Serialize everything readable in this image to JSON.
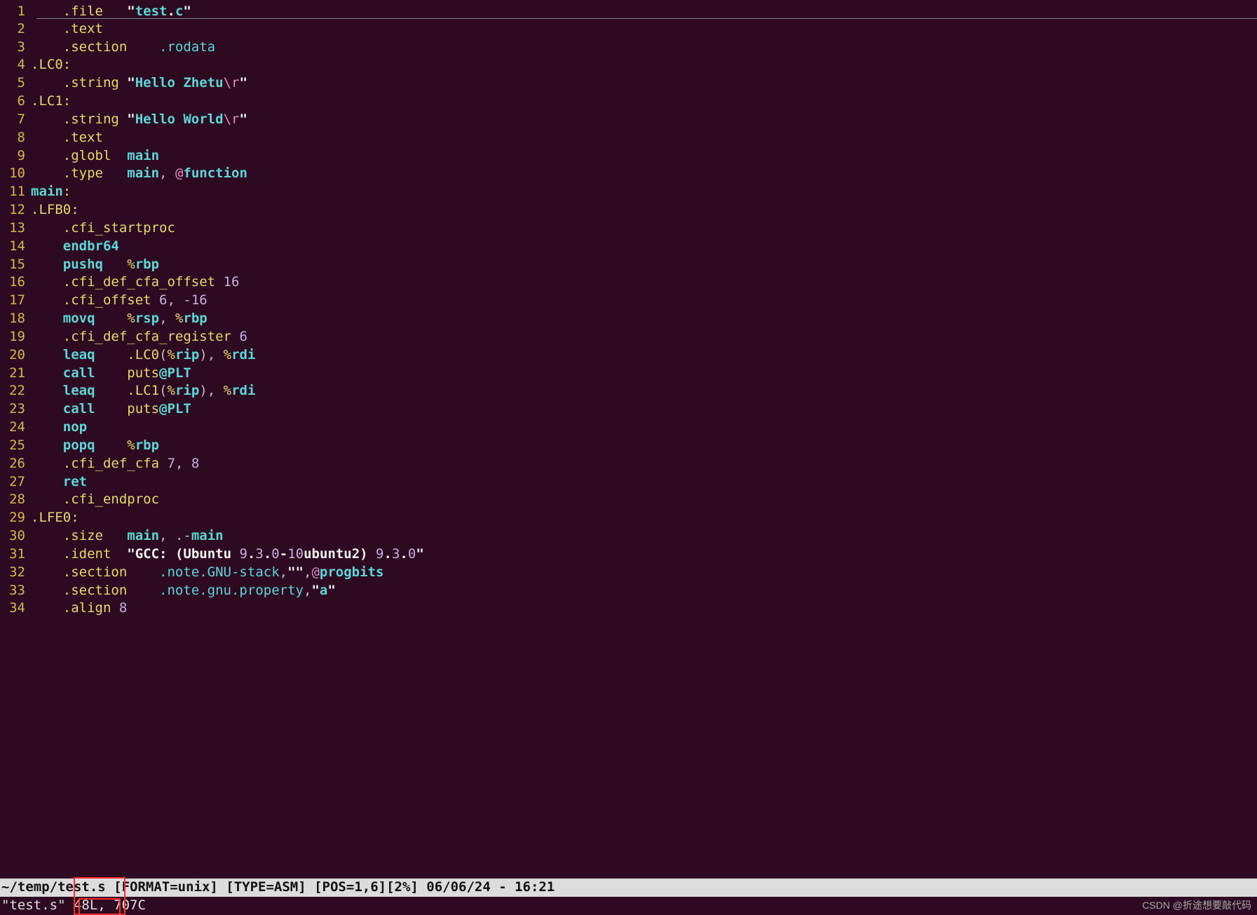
{
  "lines": [
    {
      "n": "1",
      "tokens": [
        [
          "    ",
          "c-grey"
        ],
        [
          ".file   ",
          "c-yellow"
        ],
        [
          "\"",
          "c-white"
        ],
        [
          "test",
          "c-cyanb"
        ],
        [
          ".",
          "c-white"
        ],
        [
          "c",
          "c-cyanb"
        ],
        [
          "\"",
          "c-white"
        ]
      ]
    },
    {
      "n": "2",
      "tokens": [
        [
          "    ",
          "c-grey"
        ],
        [
          ".text",
          "c-yellow"
        ]
      ]
    },
    {
      "n": "3",
      "tokens": [
        [
          "    ",
          "c-grey"
        ],
        [
          ".section    ",
          "c-yellow"
        ],
        [
          ".rodata",
          "c-cyan"
        ]
      ]
    },
    {
      "n": "4",
      "tokens": [
        [
          ".LC0:",
          "c-yellow"
        ]
      ]
    },
    {
      "n": "5",
      "tokens": [
        [
          "    ",
          "c-grey"
        ],
        [
          ".string ",
          "c-yellow"
        ],
        [
          "\"",
          "c-white"
        ],
        [
          "Hello Zhetu",
          "c-cyanb"
        ],
        [
          "\\r",
          "c-pink"
        ],
        [
          "\"",
          "c-white"
        ]
      ]
    },
    {
      "n": "6",
      "tokens": [
        [
          ".LC1:",
          "c-yellow"
        ]
      ]
    },
    {
      "n": "7",
      "tokens": [
        [
          "    ",
          "c-grey"
        ],
        [
          ".string ",
          "c-yellow"
        ],
        [
          "\"",
          "c-white"
        ],
        [
          "Hello World",
          "c-cyanb"
        ],
        [
          "\\r",
          "c-pink"
        ],
        [
          "\"",
          "c-white"
        ]
      ]
    },
    {
      "n": "8",
      "tokens": [
        [
          "    ",
          "c-grey"
        ],
        [
          ".text",
          "c-yellow"
        ]
      ]
    },
    {
      "n": "9",
      "tokens": [
        [
          "    ",
          "c-grey"
        ],
        [
          ".globl  ",
          "c-yellow"
        ],
        [
          "main",
          "c-cyanb"
        ]
      ]
    },
    {
      "n": "10",
      "tokens": [
        [
          "    ",
          "c-grey"
        ],
        [
          ".type   ",
          "c-yellow"
        ],
        [
          "main",
          "c-cyanb"
        ],
        [
          ", ",
          "c-grey"
        ],
        [
          "@",
          "c-pink"
        ],
        [
          "function",
          "c-cyanb"
        ]
      ]
    },
    {
      "n": "11",
      "tokens": [
        [
          "main",
          "c-cyanb"
        ],
        [
          ":",
          "c-yellow"
        ]
      ]
    },
    {
      "n": "12",
      "tokens": [
        [
          ".LFB0:",
          "c-yellow"
        ]
      ]
    },
    {
      "n": "13",
      "tokens": [
        [
          "    ",
          "c-grey"
        ],
        [
          ".cfi_startproc",
          "c-yellow"
        ]
      ]
    },
    {
      "n": "14",
      "tokens": [
        [
          "    ",
          "c-grey"
        ],
        [
          "endbr64",
          "c-cyanb"
        ]
      ]
    },
    {
      "n": "15",
      "tokens": [
        [
          "    ",
          "c-grey"
        ],
        [
          "pushq   ",
          "c-cyanb"
        ],
        [
          "%",
          "c-yellow"
        ],
        [
          "rbp",
          "c-cyanb"
        ]
      ]
    },
    {
      "n": "16",
      "tokens": [
        [
          "    ",
          "c-grey"
        ],
        [
          ".cfi_def_cfa_offset ",
          "c-yellow"
        ],
        [
          "16",
          "c-num"
        ]
      ]
    },
    {
      "n": "17",
      "tokens": [
        [
          "    ",
          "c-grey"
        ],
        [
          ".cfi_offset ",
          "c-yellow"
        ],
        [
          "6",
          "c-num"
        ],
        [
          ", ",
          "c-grey"
        ],
        [
          "-",
          "c-grey"
        ],
        [
          "16",
          "c-num"
        ]
      ]
    },
    {
      "n": "18",
      "tokens": [
        [
          "    ",
          "c-grey"
        ],
        [
          "movq    ",
          "c-cyanb"
        ],
        [
          "%",
          "c-yellow"
        ],
        [
          "rsp",
          "c-cyanb"
        ],
        [
          ", ",
          "c-grey"
        ],
        [
          "%",
          "c-yellow"
        ],
        [
          "rbp",
          "c-cyanb"
        ]
      ]
    },
    {
      "n": "19",
      "tokens": [
        [
          "    ",
          "c-grey"
        ],
        [
          ".cfi_def_cfa_register ",
          "c-yellow"
        ],
        [
          "6",
          "c-num"
        ]
      ]
    },
    {
      "n": "20",
      "tokens": [
        [
          "    ",
          "c-grey"
        ],
        [
          "leaq    ",
          "c-cyanb"
        ],
        [
          ".LC0",
          "c-yellow"
        ],
        [
          "(",
          "c-grey"
        ],
        [
          "%",
          "c-yellow"
        ],
        [
          "rip",
          "c-cyanb"
        ],
        [
          ")",
          "c-grey"
        ],
        [
          ", ",
          "c-grey"
        ],
        [
          "%",
          "c-yellow"
        ],
        [
          "rdi",
          "c-cyanb"
        ]
      ]
    },
    {
      "n": "21",
      "tokens": [
        [
          "    ",
          "c-grey"
        ],
        [
          "call    ",
          "c-cyanb"
        ],
        [
          "puts",
          "c-yellow"
        ],
        [
          "@",
          "c-cyanb"
        ],
        [
          "PLT",
          "c-cyanb"
        ]
      ]
    },
    {
      "n": "22",
      "tokens": [
        [
          "    ",
          "c-grey"
        ],
        [
          "leaq    ",
          "c-cyanb"
        ],
        [
          ".LC1",
          "c-yellow"
        ],
        [
          "(",
          "c-grey"
        ],
        [
          "%",
          "c-yellow"
        ],
        [
          "rip",
          "c-cyanb"
        ],
        [
          ")",
          "c-grey"
        ],
        [
          ", ",
          "c-grey"
        ],
        [
          "%",
          "c-yellow"
        ],
        [
          "rdi",
          "c-cyanb"
        ]
      ]
    },
    {
      "n": "23",
      "tokens": [
        [
          "    ",
          "c-grey"
        ],
        [
          "call    ",
          "c-cyanb"
        ],
        [
          "puts",
          "c-yellow"
        ],
        [
          "@",
          "c-cyanb"
        ],
        [
          "PLT",
          "c-cyanb"
        ]
      ]
    },
    {
      "n": "24",
      "tokens": [
        [
          "    ",
          "c-grey"
        ],
        [
          "nop",
          "c-cyanb"
        ]
      ]
    },
    {
      "n": "25",
      "tokens": [
        [
          "    ",
          "c-grey"
        ],
        [
          "popq    ",
          "c-cyanb"
        ],
        [
          "%",
          "c-yellow"
        ],
        [
          "rbp",
          "c-cyanb"
        ]
      ]
    },
    {
      "n": "26",
      "tokens": [
        [
          "    ",
          "c-grey"
        ],
        [
          ".cfi_def_cfa ",
          "c-yellow"
        ],
        [
          "7",
          "c-num"
        ],
        [
          ", ",
          "c-grey"
        ],
        [
          "8",
          "c-num"
        ]
      ]
    },
    {
      "n": "27",
      "tokens": [
        [
          "    ",
          "c-grey"
        ],
        [
          "ret",
          "c-cyanb"
        ]
      ]
    },
    {
      "n": "28",
      "tokens": [
        [
          "    ",
          "c-grey"
        ],
        [
          ".cfi_endproc",
          "c-yellow"
        ]
      ]
    },
    {
      "n": "29",
      "tokens": [
        [
          ".LFE0:",
          "c-yellow"
        ]
      ]
    },
    {
      "n": "30",
      "tokens": [
        [
          "    ",
          "c-grey"
        ],
        [
          ".size   ",
          "c-yellow"
        ],
        [
          "main",
          "c-cyanb"
        ],
        [
          ", .-",
          "c-grey"
        ],
        [
          "main",
          "c-cyanb"
        ]
      ]
    },
    {
      "n": "31",
      "tokens": [
        [
          "    ",
          "c-grey"
        ],
        [
          ".ident  ",
          "c-yellow"
        ],
        [
          "\"",
          "c-white"
        ],
        [
          "GCC: ",
          "c-white"
        ],
        [
          "(",
          "c-white"
        ],
        [
          "Ubuntu ",
          "c-white"
        ],
        [
          "9",
          "c-num"
        ],
        [
          ".",
          "c-white"
        ],
        [
          "3",
          "c-num"
        ],
        [
          ".",
          "c-white"
        ],
        [
          "0",
          "c-num"
        ],
        [
          "-",
          "c-white"
        ],
        [
          "10",
          "c-num"
        ],
        [
          "ubuntu2",
          "c-white"
        ],
        [
          ") ",
          "c-white"
        ],
        [
          "9",
          "c-num"
        ],
        [
          ".",
          "c-white"
        ],
        [
          "3",
          "c-num"
        ],
        [
          ".",
          "c-white"
        ],
        [
          "0",
          "c-num"
        ],
        [
          "\"",
          "c-white"
        ]
      ]
    },
    {
      "n": "32",
      "tokens": [
        [
          "    ",
          "c-grey"
        ],
        [
          ".section    ",
          "c-yellow"
        ],
        [
          ".note.GNU-stack",
          "c-cyan"
        ],
        [
          ",",
          "c-grey"
        ],
        [
          "\"\"",
          "c-white"
        ],
        [
          ",",
          "c-grey"
        ],
        [
          "@",
          "c-pink"
        ],
        [
          "progbits",
          "c-cyanb"
        ]
      ]
    },
    {
      "n": "33",
      "tokens": [
        [
          "    ",
          "c-grey"
        ],
        [
          ".section    ",
          "c-yellow"
        ],
        [
          ".note.gnu.property",
          "c-cyan"
        ],
        [
          ",",
          "c-grey"
        ],
        [
          "\"",
          "c-white"
        ],
        [
          "a",
          "c-cyanb"
        ],
        [
          "\"",
          "c-white"
        ]
      ]
    },
    {
      "n": "34",
      "tokens": [
        [
          "    ",
          "c-grey"
        ],
        [
          ".align ",
          "c-yellow"
        ],
        [
          "8",
          "c-num"
        ]
      ]
    }
  ],
  "statusbar": "~/temp/test.s [FORMAT=unix] [TYPE=ASM] [POS=1,6][2%] 06/06/24 - 16:21",
  "cmdline": "\"test.s\" 48L, 707C",
  "watermark": "CSDN @折途想要敲代码"
}
